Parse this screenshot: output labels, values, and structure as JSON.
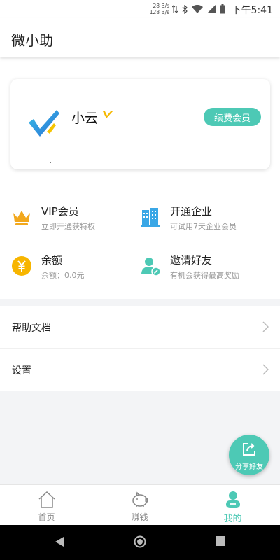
{
  "status_bar": {
    "net_up": "28 B/s",
    "net_down": "128 B/s",
    "time": "下午5:41"
  },
  "app_bar": {
    "title": "微小助"
  },
  "profile": {
    "username": "小云",
    "renew_button": "续费会员"
  },
  "features": [
    {
      "title": "VIP会员",
      "subtitle": "立即开通获特权",
      "icon": "crown-icon"
    },
    {
      "title": "开通企业",
      "subtitle": "可试用7天企业会员",
      "icon": "building-icon"
    },
    {
      "title": "余额",
      "subtitle": "余额：0.0元",
      "icon": "yuan-coin-icon"
    },
    {
      "title": "邀请好友",
      "subtitle": "有机会获得最高奖励",
      "icon": "invite-user-icon"
    }
  ],
  "menu": [
    {
      "label": "帮助文档"
    },
    {
      "label": "设置"
    }
  ],
  "fab": {
    "label": "分享好友"
  },
  "tabs": [
    {
      "label": "首页",
      "icon": "home-icon"
    },
    {
      "label": "赚钱",
      "icon": "piggy-bank-icon"
    },
    {
      "label": "我的",
      "icon": "profile-icon",
      "active": true
    }
  ],
  "colors": {
    "accent": "#4dc9b5",
    "crown": "#f2a81d",
    "building": "#3aa7e6",
    "coin": "#f7b500"
  }
}
